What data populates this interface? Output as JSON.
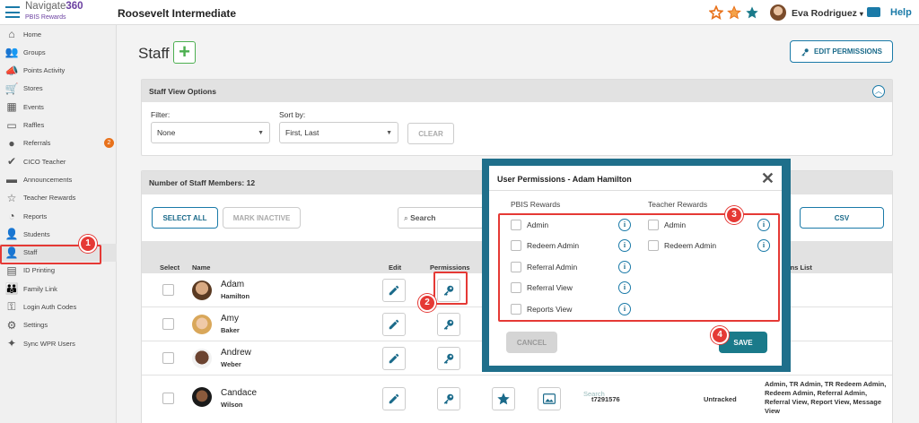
{
  "topbar": {
    "brand_name": "Navigate",
    "brand_number": "360",
    "brand_sub": "PBIS Rewards",
    "school": "Roosevelt Intermediate",
    "user_name": "Eva Rodriguez",
    "user_caret": "▾",
    "help": "Help",
    "colors": {
      "accent": "#1a7aa8",
      "star_orange": "#e8711a",
      "star_blue": "#1a7a8a"
    }
  },
  "sidebar": {
    "items": [
      {
        "label": "Home",
        "icon": "home-icon"
      },
      {
        "label": "Groups",
        "icon": "groups-icon"
      },
      {
        "label": "Points Activity",
        "icon": "megaphone-icon"
      },
      {
        "label": "Stores",
        "icon": "cart-icon"
      },
      {
        "label": "Events",
        "icon": "calendar-icon"
      },
      {
        "label": "Raffles",
        "icon": "ticket-icon"
      },
      {
        "label": "Referrals",
        "icon": "alert-icon",
        "badge": "2"
      },
      {
        "label": "CICO Teacher",
        "icon": "check-circle-icon"
      },
      {
        "label": "Announcements",
        "icon": "chat-icon"
      },
      {
        "label": "Teacher Rewards",
        "icon": "star-icon"
      },
      {
        "label": "Reports",
        "icon": "pie-chart-icon"
      },
      {
        "label": "Students",
        "icon": "students-icon"
      },
      {
        "label": "Staff",
        "icon": "person-icon",
        "active": true
      },
      {
        "label": "ID Printing",
        "icon": "printer-icon"
      },
      {
        "label": "Family Link",
        "icon": "family-icon"
      },
      {
        "label": "Login Auth Codes",
        "icon": "key-icon"
      },
      {
        "label": "Settings",
        "icon": "gear-icon"
      },
      {
        "label": "Sync WPR Users",
        "icon": "wand-icon"
      }
    ]
  },
  "main": {
    "title": "Staff",
    "add_symbol": "+",
    "edit_permissions": "EDIT PERMISSIONS",
    "view_options": {
      "title": "Staff View Options",
      "filter_label": "Filter:",
      "filter_value": "None",
      "sort_label": "Sort by:",
      "sort_value": "First, Last",
      "clear": "CLEAR"
    },
    "staff_panel": {
      "title": "Number of Staff Members: 12",
      "select_all": "SELECT ALL",
      "mark_inactive": "MARK INACTIVE",
      "search_placeholder": "Search",
      "csv": "CSV",
      "columns": {
        "select": "Select",
        "name": "Name",
        "edit": "Edit",
        "permissions": "Permissions",
        "permissions_list": "ions List"
      },
      "hidden_search": "Search",
      "rows": [
        {
          "first": "Adam",
          "last": "Hamilton"
        },
        {
          "first": "Amy",
          "last": "Baker"
        },
        {
          "first": "Andrew",
          "last": "Weber"
        },
        {
          "first": "Candace",
          "last": "Wilson",
          "id": "t7291576",
          "tracking": "Untracked",
          "permissions_list": "Admin, TR Admin, TR Redeem Admin, Redeem Admin, Referral Admin, Referral View, Report View, Message View"
        }
      ]
    }
  },
  "modal": {
    "title": "User Permissions - Adam Hamilton",
    "close": "✕",
    "pbis_heading": "PBIS Rewards",
    "teacher_heading": "Teacher Rewards",
    "pbis_permissions": [
      "Admin",
      "Redeem Admin",
      "Referral Admin",
      "Referral View",
      "Reports View"
    ],
    "teacher_permissions": [
      "Admin",
      "Redeem Admin"
    ],
    "info_glyph": "i",
    "cancel": "CANCEL",
    "save": "SAVE"
  },
  "annotations": {
    "callouts": [
      "1",
      "2",
      "3",
      "4"
    ],
    "color": "#e53935"
  }
}
